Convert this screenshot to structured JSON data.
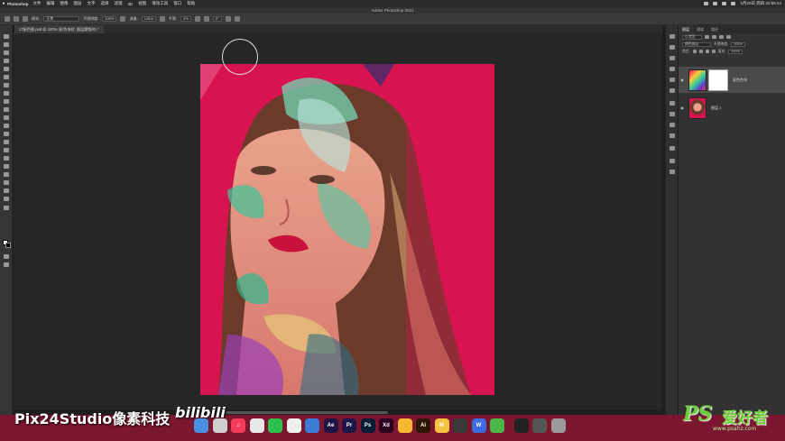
{
  "menubar": {
    "app_name": "Photoshop",
    "items": [
      "文件",
      "编辑",
      "图像",
      "图层",
      "文字",
      "选择",
      "滤镜",
      "3D",
      "视图",
      "增效工具",
      "窗口",
      "帮助"
    ],
    "clock": "5月20日 周四  22:55:44"
  },
  "window": {
    "title": "Adobe Photoshop 2021"
  },
  "options": {
    "mode_label": "模式:",
    "mode_value": "正常",
    "opacity_label": "不透明度:",
    "opacity_value": "100%",
    "flow_label": "流量:",
    "flow_value": "100%",
    "smooth_label": "平滑:",
    "smooth_value": "0%",
    "angle_value": "0°"
  },
  "document": {
    "tab_label": "17配色图.psd @ 100% (彩色块状, 图层蒙版/8) *"
  },
  "layers_panel": {
    "tabs": [
      "图层",
      "通道",
      "路径"
    ],
    "kind_label": "Q 类型",
    "blend_mode": "颜色减淡",
    "opacity_label": "不透明度:",
    "opacity_value": "100%",
    "lock_label": "锁定:",
    "fill_label": "填充:",
    "fill_value": "100%",
    "layers": [
      {
        "name": "彩色色块"
      },
      {
        "name": "图层 1"
      }
    ]
  },
  "overlay": {
    "studio_watermark": "Pix24Studio像素科技",
    "bili_logo": "bilibili",
    "ps_logo": "PS",
    "ps_logo_cn": "爱好者",
    "ps_url": "www.psahz.com"
  },
  "dock": {
    "icons": [
      {
        "name": "finder-icon",
        "label": "",
        "color": "#4a90e2"
      },
      {
        "name": "launchpad-icon",
        "label": "",
        "color": "#cfcfcf"
      },
      {
        "name": "music-icon",
        "label": "♫",
        "color": "#f23c5a"
      },
      {
        "name": "chrome-icon",
        "label": "",
        "color": "#e8e8e8"
      },
      {
        "name": "wechat-icon",
        "label": "",
        "color": "#2bc24a"
      },
      {
        "name": "qq-icon",
        "label": "",
        "color": "#f0f0f0"
      },
      {
        "name": "safari-icon",
        "label": "",
        "color": "#3a7bd5"
      },
      {
        "name": "after-effects-icon",
        "label": "Ae",
        "color": "#1f1446"
      },
      {
        "name": "premiere-icon",
        "label": "Pr",
        "color": "#1f1446"
      },
      {
        "name": "photoshop-icon",
        "label": "Ps",
        "color": "#061d36"
      },
      {
        "name": "xd-icon",
        "label": "Xd",
        "color": "#2e001f"
      },
      {
        "name": "sketch-icon",
        "label": "",
        "color": "#f7b733"
      },
      {
        "name": "illustrator-icon",
        "label": "Ai",
        "color": "#2e1500"
      },
      {
        "name": "miro-icon",
        "label": "M",
        "color": "#f5c242"
      },
      {
        "name": "davinci-icon",
        "label": "",
        "color": "#3a3a3a"
      },
      {
        "name": "wps-icon",
        "label": "W",
        "color": "#3b6de0"
      },
      {
        "name": "camtasia-icon",
        "label": "",
        "color": "#4cb84a"
      },
      {
        "name": "activity-monitor-icon",
        "label": "",
        "color": "#222"
      },
      {
        "name": "app-extra-icon",
        "label": "",
        "color": "#555"
      },
      {
        "name": "trash-icon",
        "label": "",
        "color": "#9a9a9a"
      }
    ]
  }
}
